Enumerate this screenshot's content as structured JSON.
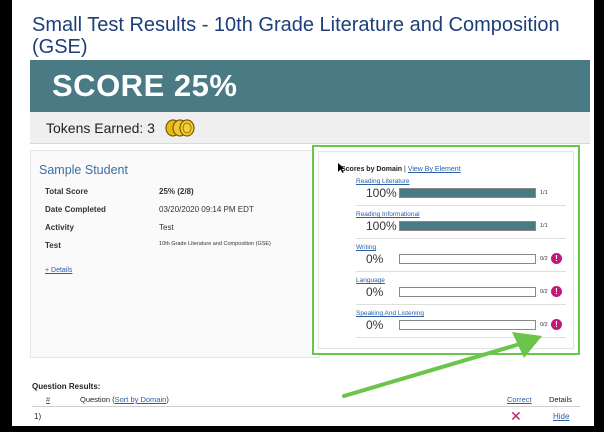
{
  "page": {
    "title": "Small Test Results - 10th Grade Literature and Composition (GSE)"
  },
  "score": {
    "label": "SCORE 25%"
  },
  "tokens": {
    "label": "Tokens Earned: 3"
  },
  "student": {
    "name": "Sample Student",
    "rows": [
      {
        "label": "Total Score",
        "value": "25% (2/8)"
      },
      {
        "label": "Date Completed",
        "value": "03/20/2020 09:14 PM EDT"
      },
      {
        "label": "Activity",
        "value": "Test"
      },
      {
        "label": "Test",
        "value": "10th Grade Literature and Composition (GSE)"
      }
    ],
    "details_link": "+ Details"
  },
  "domains": {
    "header_bold": "Scores by Domain",
    "separator": "|",
    "view_link": "View By Element",
    "items": [
      {
        "name": "Reading Literature",
        "pct_label": "100%",
        "fill": 1.0,
        "frac": "1/1",
        "alert": false
      },
      {
        "name": "Reading Informational",
        "pct_label": "100%",
        "fill": 1.0,
        "frac": "1/1",
        "alert": false
      },
      {
        "name": "Writing",
        "pct_label": "0%",
        "fill": 0.0,
        "frac": "0/2",
        "alert": true
      },
      {
        "name": "Language",
        "pct_label": "0%",
        "fill": 0.0,
        "frac": "0/2",
        "alert": true
      },
      {
        "name": "Speaking And Listening",
        "pct_label": "0%",
        "fill": 0.0,
        "frac": "0/2",
        "alert": true
      }
    ],
    "alert_icon_glyph": "!"
  },
  "results": {
    "title": "Question Results:",
    "col_hash": "#",
    "col_question": "Question",
    "sort_open": "(",
    "sort_link": "Sort by Domain",
    "sort_close": ")",
    "col_correct": "Correct",
    "col_details": "Details",
    "rows": [
      {
        "num": "1)",
        "mark": "✕",
        "action": "Hide"
      }
    ]
  },
  "colors": {
    "title": "#1c3f7a",
    "score_band": "#4a7b85",
    "highlight": "#6ac54a",
    "link": "#2a5ea8",
    "alert": "#c2187a"
  },
  "icons": {
    "coins": "gold-coins-icon",
    "cursor": "mouse-pointer-icon",
    "alert": "exclamation-circle-icon",
    "incorrect": "red-x-icon",
    "annotation": "green-arrow-annotation"
  }
}
